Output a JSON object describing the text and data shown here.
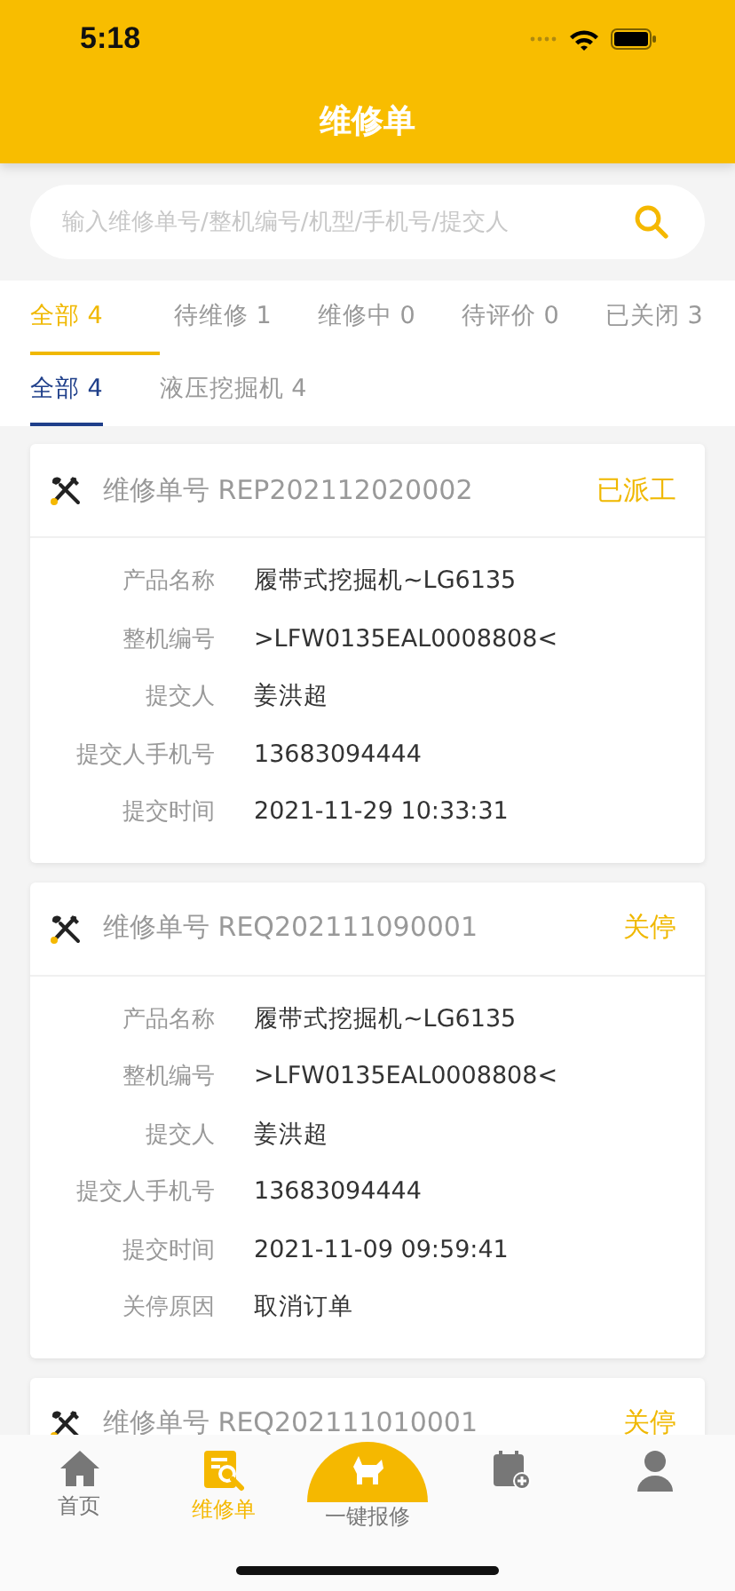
{
  "status_bar": {
    "time": "5:18"
  },
  "header": {
    "title": "维修单"
  },
  "search": {
    "placeholder": "输入维修单号/整机编号/机型/手机号/提交人"
  },
  "status_tabs": [
    {
      "label": "全部 4",
      "selected": true
    },
    {
      "label": "待维修 1",
      "selected": false
    },
    {
      "label": "维修中 0",
      "selected": false
    },
    {
      "label": "待评价 0",
      "selected": false
    },
    {
      "label": "已关闭 3",
      "selected": false
    }
  ],
  "type_tabs": [
    {
      "label": "全部 4",
      "selected": true
    },
    {
      "label": "液压挖掘机 4",
      "selected": false
    }
  ],
  "orders": [
    {
      "title": "维修单号 REP202112020002",
      "status": "已派工",
      "fields": [
        {
          "label": "产品名称",
          "value": "履带式挖掘机~LG6135"
        },
        {
          "label": "整机编号",
          "value": ">LFW0135EAL0008808<"
        },
        {
          "label": "提交人",
          "value": "姜洪超"
        },
        {
          "label": "提交人手机号",
          "value": "13683094444"
        },
        {
          "label": "提交时间",
          "value": "2021-11-29 10:33:31"
        }
      ]
    },
    {
      "title": "维修单号 REQ202111090001",
      "status": "关停",
      "fields": [
        {
          "label": "产品名称",
          "value": "履带式挖掘机~LG6135"
        },
        {
          "label": "整机编号",
          "value": ">LFW0135EAL0008808<"
        },
        {
          "label": "提交人",
          "value": "姜洪超"
        },
        {
          "label": "提交人手机号",
          "value": "13683094444"
        },
        {
          "label": "提交时间",
          "value": "2021-11-09 09:59:41"
        },
        {
          "label": "关停原因",
          "value": "取消订单"
        }
      ]
    },
    {
      "title": "维修单号 REQ202111010001",
      "status": "关停"
    }
  ],
  "tab_bar": [
    {
      "kind": "home",
      "label": "首页",
      "selected": false
    },
    {
      "kind": "orders",
      "label": "维修单",
      "selected": true
    },
    {
      "kind": "report",
      "label": "一键报修",
      "selected": false
    },
    {
      "kind": "calendar",
      "selected": false
    },
    {
      "kind": "profile",
      "selected": false
    }
  ]
}
